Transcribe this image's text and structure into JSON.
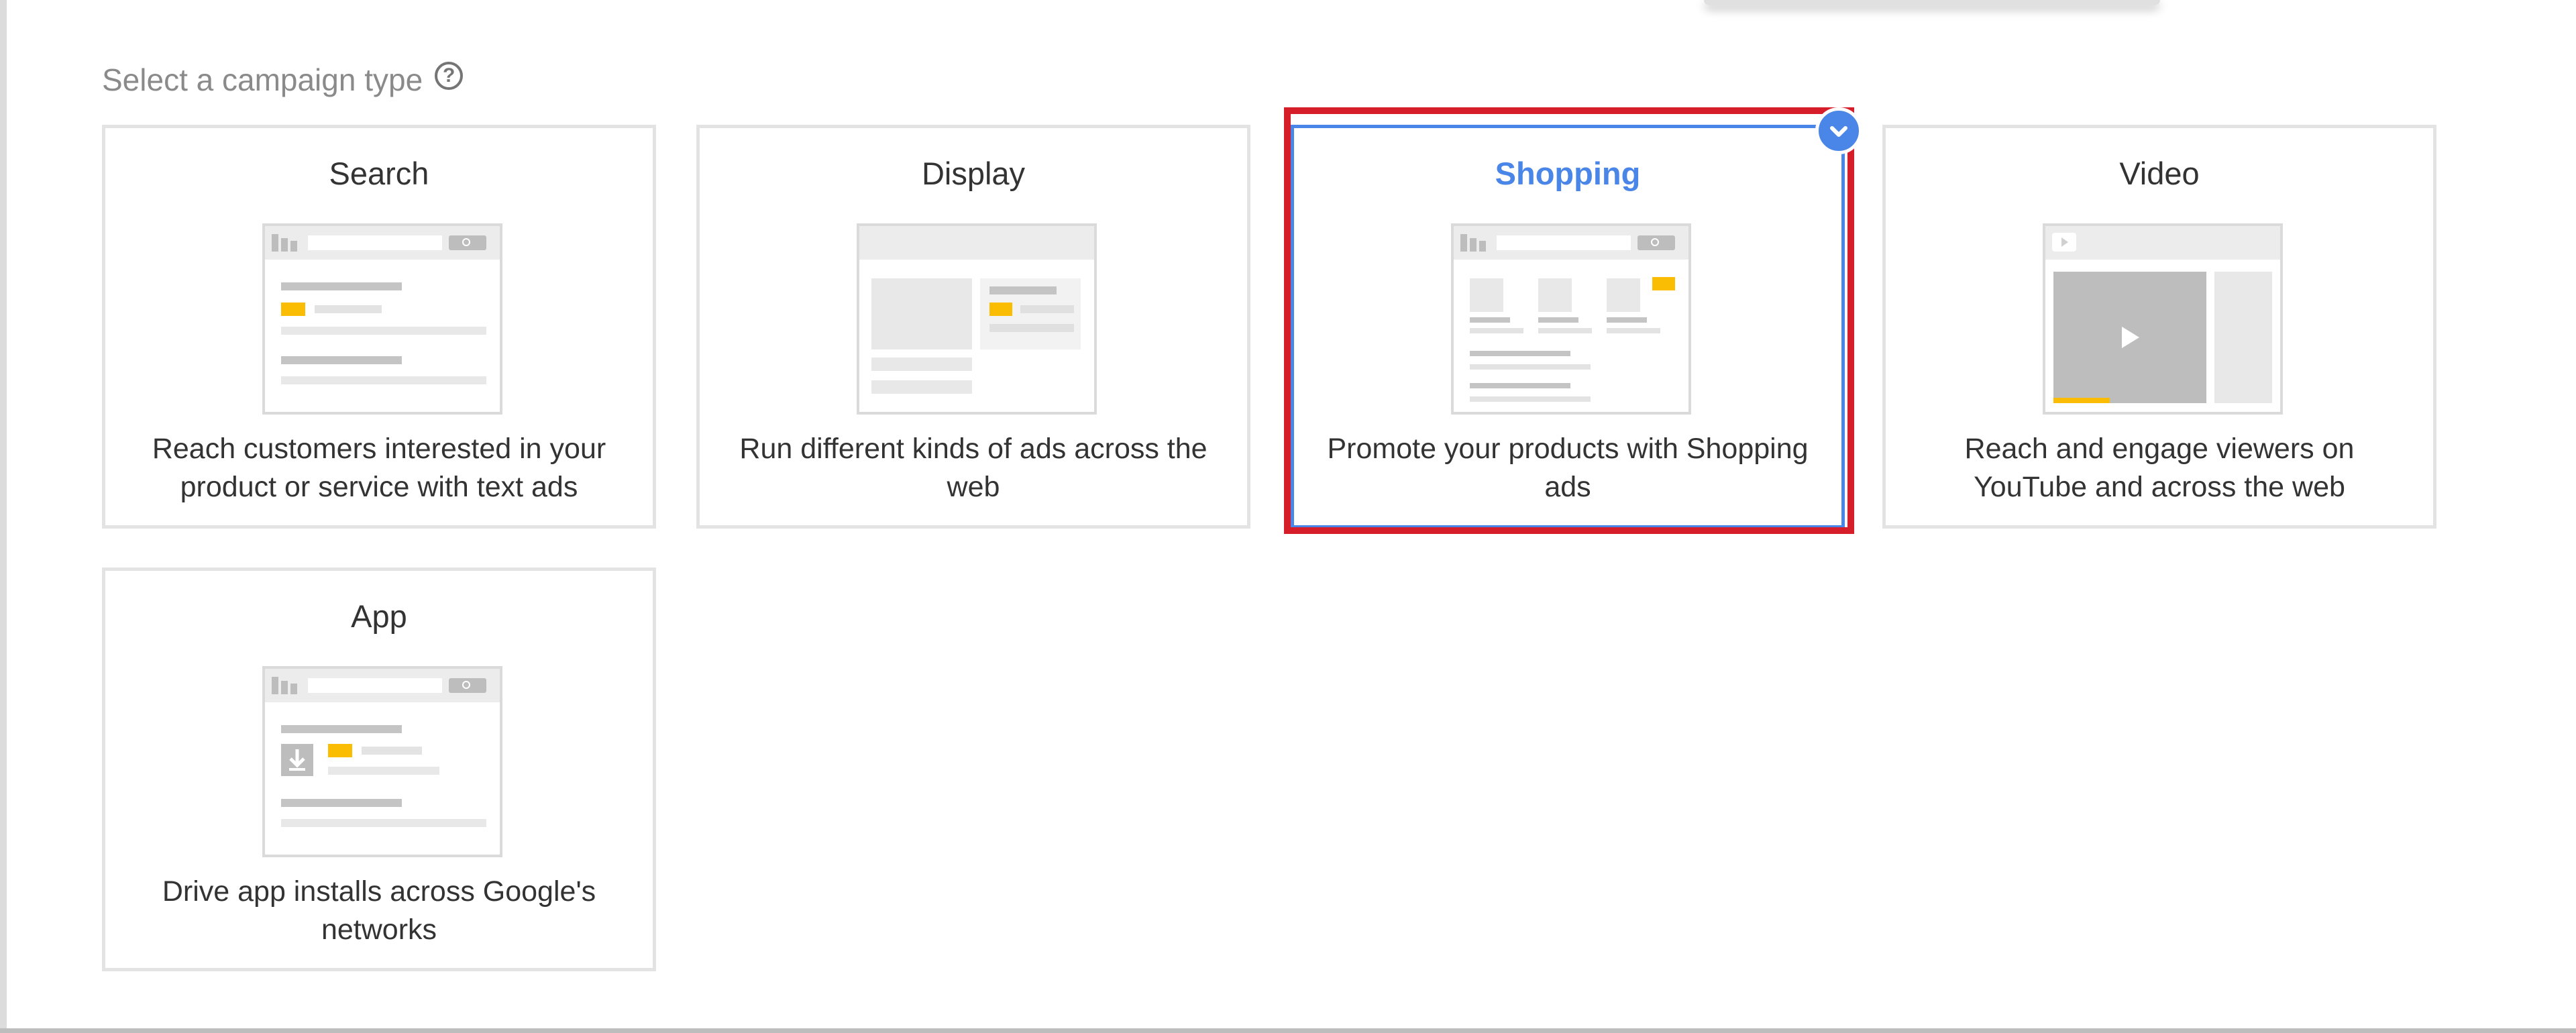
{
  "header": {
    "title": "Select a campaign type",
    "help_icon": "help-circle-icon"
  },
  "cards": [
    {
      "id": "search",
      "title": "Search",
      "description": "Reach customers interested in your product or service with text ads",
      "selected": false
    },
    {
      "id": "display",
      "title": "Display",
      "description": "Run different kinds of ads across the web",
      "selected": false
    },
    {
      "id": "shopping",
      "title": "Shopping",
      "description": "Promote your products with Shopping ads",
      "selected": true
    },
    {
      "id": "video",
      "title": "Video",
      "description": "Reach and engage viewers on YouTube and across the web",
      "selected": false
    },
    {
      "id": "app",
      "title": "App",
      "description": "Drive app installs across Google's networks",
      "selected": false
    }
  ],
  "colors": {
    "accent_blue": "#4a86e8",
    "highlight_red": "#d61d2a",
    "ad_yellow": "#fbbc04",
    "border_gray": "#e3e3e3"
  }
}
